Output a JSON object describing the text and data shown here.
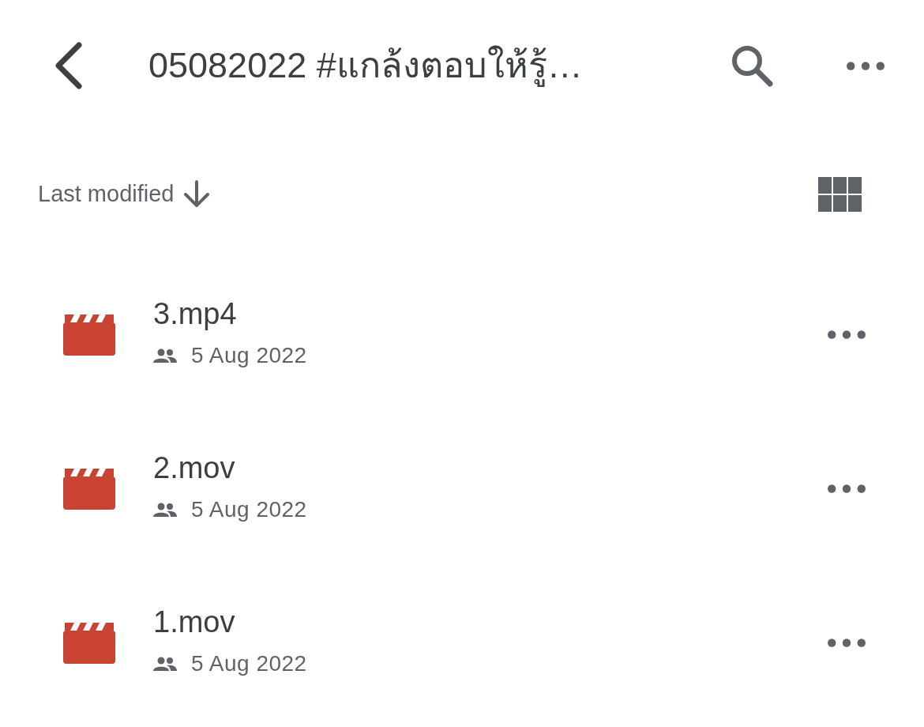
{
  "header": {
    "title": "05082022 #แกล้งตอบให้รู้…"
  },
  "sort": {
    "label": "Last modified"
  },
  "files": [
    {
      "name": "3.mp4",
      "date": "5 Aug 2022"
    },
    {
      "name": "2.mov",
      "date": "5 Aug 2022"
    },
    {
      "name": "1.mov",
      "date": "5 Aug 2022"
    }
  ]
}
